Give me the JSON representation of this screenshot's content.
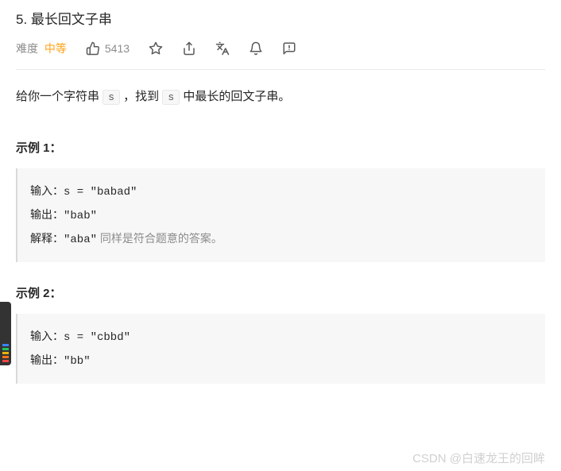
{
  "title": "5. 最长回文子串",
  "meta": {
    "difficulty_label": "难度",
    "difficulty_value": "中等",
    "likes": "5413"
  },
  "description": {
    "prefix": "给你一个字符串 ",
    "var": "s",
    "mid": "，找到 ",
    "var2": "s",
    "suffix": " 中最长的回文子串。"
  },
  "examples": [
    {
      "heading": "示例 1：",
      "input_label": "输入：",
      "input_value": "s = \"babad\"",
      "output_label": "输出：",
      "output_value": "\"bab\"",
      "explain_label": "解释：",
      "explain_code": "\"aba\"",
      "explain_text": " 同样是符合题意的答案。"
    },
    {
      "heading": "示例 2：",
      "input_label": "输入：",
      "input_value": "s = \"cbbd\"",
      "output_label": "输出：",
      "output_value": "\"bb\""
    }
  ],
  "watermark": "CSDN @白速龙王的回眸"
}
